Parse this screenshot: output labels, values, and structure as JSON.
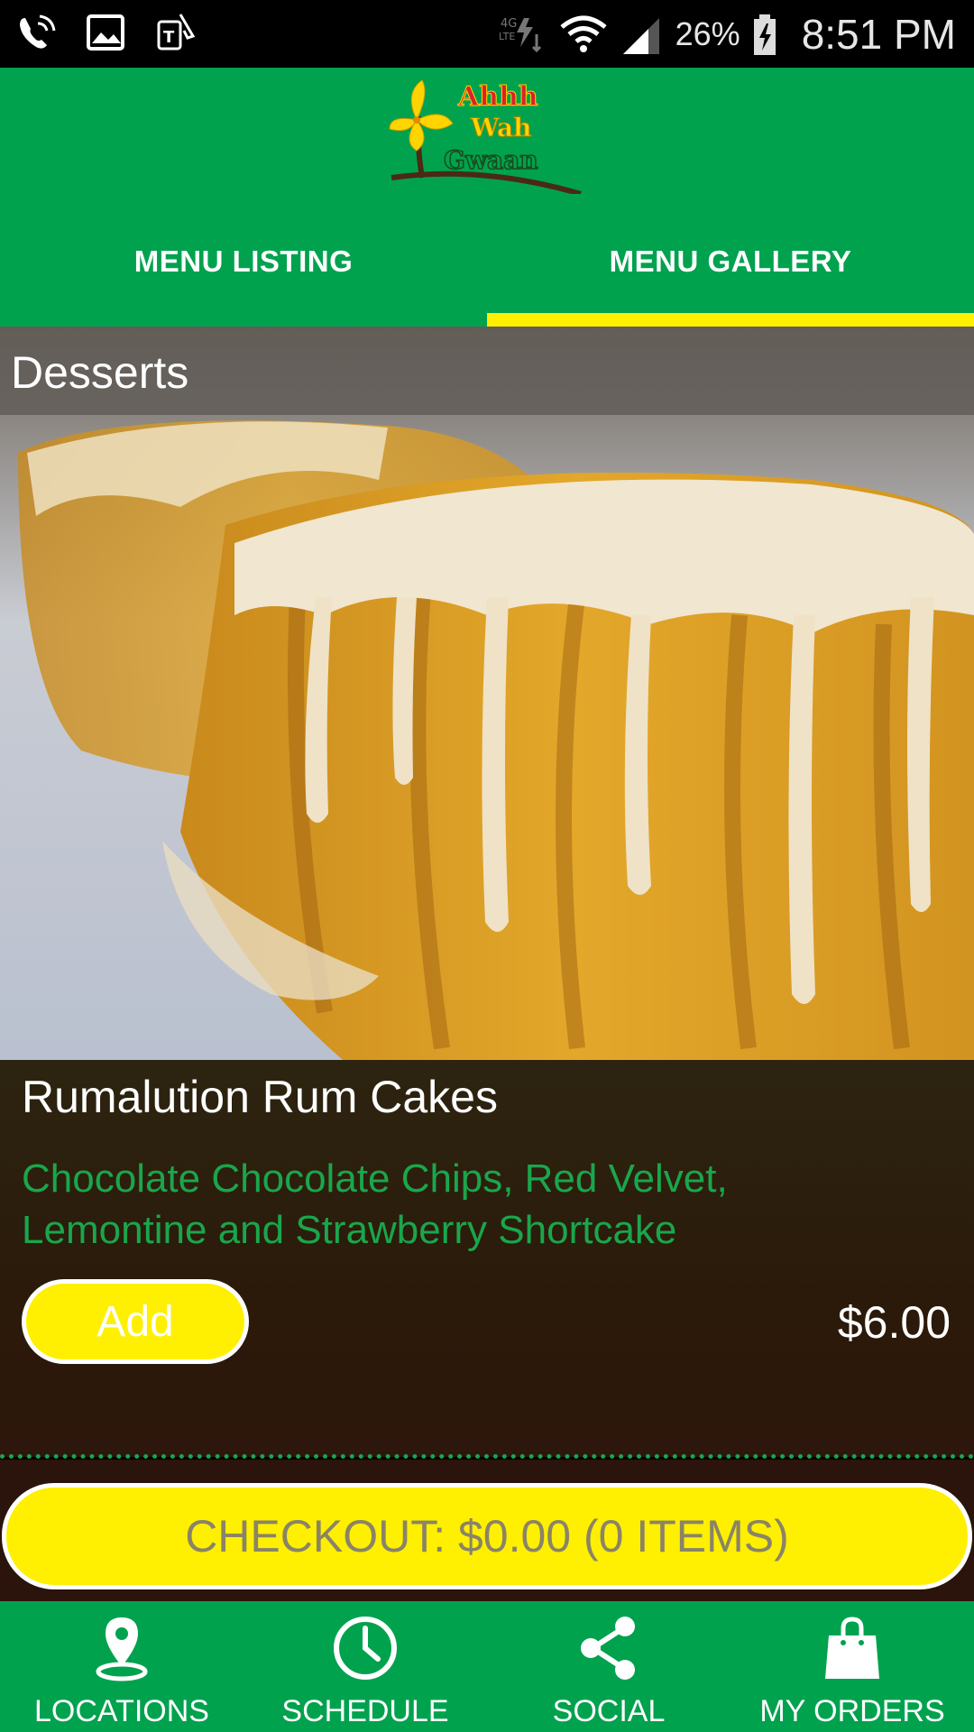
{
  "status_bar": {
    "battery_percent": "26%",
    "time": "8:51 PM",
    "left_icons": [
      "wifi-call-icon",
      "image-icon",
      "t-mobile-icon"
    ],
    "right_icons": [
      "data-4g-icon",
      "wifi-icon",
      "signal-icon",
      "battery-charging-icon"
    ]
  },
  "header": {
    "logo_text": [
      "Ahhh",
      "Wah",
      "Gwaan"
    ],
    "colors": {
      "background": "#00a24e",
      "active_tab_indicator": "#ffef00"
    }
  },
  "tabs": [
    {
      "label": "MENU LISTING",
      "active": false
    },
    {
      "label": "MENU GALLERY",
      "active": true
    }
  ],
  "category": {
    "title": "Desserts"
  },
  "item": {
    "name": "Rumalution Rum Cakes",
    "description": "Chocolate Chocolate Chips, Red Velvet, Lemontine and Strawberry Shortcake",
    "add_label": "Add",
    "price": "$6.00",
    "image": "rum-cake-photo"
  },
  "checkout": {
    "label": "CHECKOUT: $0.00 (0 ITEMS)",
    "color": "#ffef00"
  },
  "bottom_nav": [
    {
      "label": "LOCATIONS",
      "icon": "location-pin-icon"
    },
    {
      "label": "SCHEDULE",
      "icon": "clock-icon"
    },
    {
      "label": "SOCIAL",
      "icon": "share-icon"
    },
    {
      "label": "MY ORDERS",
      "icon": "shopping-bag-icon"
    }
  ]
}
